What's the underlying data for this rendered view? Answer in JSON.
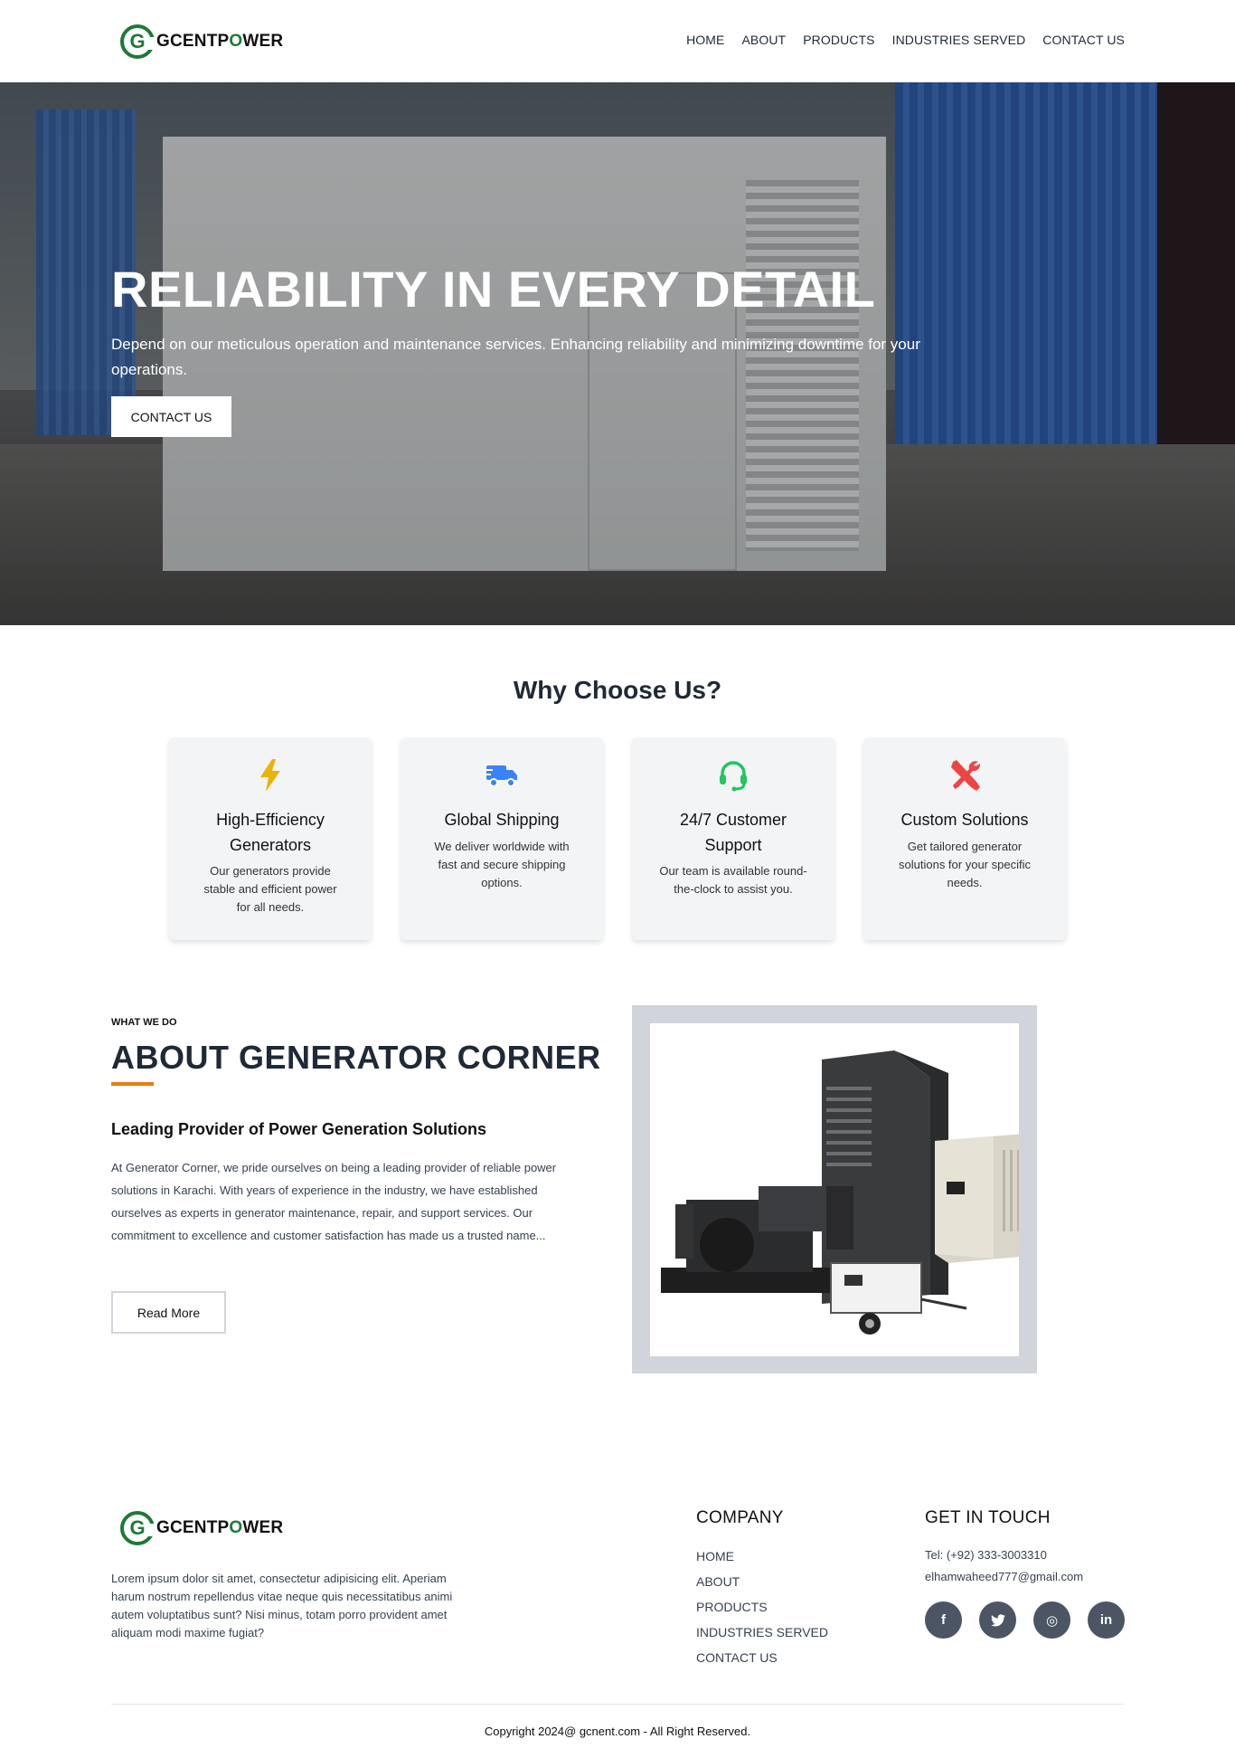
{
  "brand": {
    "logo_letter": "G",
    "name_pre": "GCENTP",
    "name_o": "O",
    "name_post": "WER"
  },
  "nav": {
    "items": [
      "HOME",
      "ABOUT",
      "PRODUCTS",
      "INDUSTRIES SERVED",
      "CONTACT US"
    ]
  },
  "hero": {
    "title": "RELIABILITY IN EVERY DETAIL",
    "subtitle": "Depend on our meticulous operation and maintenance services. Enhancing reliability and minimizing downtime for your operations.",
    "button": "CONTACT US"
  },
  "why": {
    "title": "Why Choose Us?",
    "cards": [
      {
        "icon": "bolt-icon",
        "title": "High-Efficiency Generators",
        "text": "Our generators provide stable and efficient power for all needs.",
        "color": "#eab308"
      },
      {
        "icon": "truck-icon",
        "title": "Global Shipping",
        "text": "We deliver worldwide with fast and secure shipping options.",
        "color": "#3b82f6"
      },
      {
        "icon": "headset-icon",
        "title": "24/7 Customer Support",
        "text": "Our team is available round-the-clock to assist you.",
        "color": "#22c55e"
      },
      {
        "icon": "tools-icon",
        "title": "Custom Solutions",
        "text": "Get tailored generator solutions for your specific needs.",
        "color": "#ef4444"
      }
    ]
  },
  "about": {
    "kicker": "WHAT WE DO",
    "title": "ABOUT GENERATOR CORNER",
    "subtitle": "Leading Provider of Power Generation Solutions",
    "body": "At Generator Corner, we pride ourselves on being a leading provider of reliable power solutions in Karachi. With years of experience in the industry, we have established ourselves as experts in generator maintenance, repair, and support services. Our commitment to excellence and customer satisfaction has made us a trusted name...",
    "button": "Read More",
    "accent": "#ea7a16"
  },
  "footer": {
    "text": "Lorem ipsum dolor sit amet, consectetur adipisicing elit. Aperiam harum nostrum repellendus vitae neque quis necessitatibus animi autem voluptatibus sunt? Nisi minus, totam porro provident amet aliquam modi maxime fugiat?",
    "company_heading": "COMPANY",
    "company_links": [
      "HOME",
      "ABOUT",
      "PRODUCTS",
      "INDUSTRIES SERVED",
      "CONTACT US"
    ],
    "contact_heading": "GET IN TOUCH",
    "phone": "Tel: (+92) 333-3003310",
    "email": "elhamwaheed777@gmail.com",
    "socials": [
      {
        "icon": "facebook-icon",
        "glyph": "f"
      },
      {
        "icon": "twitter-icon",
        "glyph": "t"
      },
      {
        "icon": "instagram-icon",
        "glyph": "◎"
      },
      {
        "icon": "linkedin-icon",
        "glyph": "in"
      }
    ],
    "copyright": "Copyright 2024@ gcnent.com - All Right Reserved."
  }
}
